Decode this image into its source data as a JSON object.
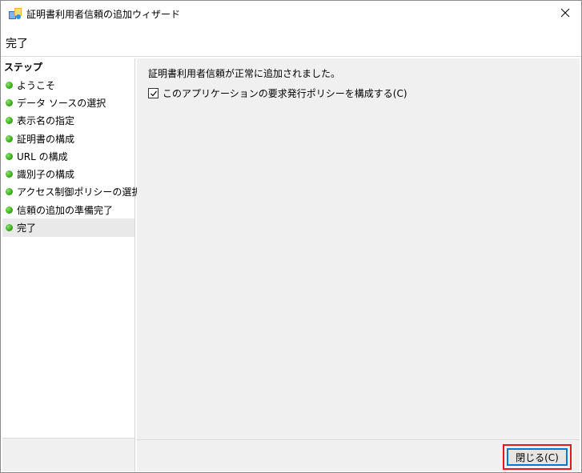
{
  "window": {
    "title": "証明書利用者信頼の追加ウィザード",
    "icon": "trust-wizard-icon",
    "close_icon": "close-icon"
  },
  "header": {
    "page_title": "完了"
  },
  "sidebar": {
    "heading": "ステップ",
    "items": [
      {
        "label": "ようこそ",
        "status": "complete"
      },
      {
        "label": "データ ソースの選択",
        "status": "complete"
      },
      {
        "label": "表示名の指定",
        "status": "complete"
      },
      {
        "label": "証明書の構成",
        "status": "complete"
      },
      {
        "label": "URL の構成",
        "status": "complete"
      },
      {
        "label": "識別子の構成",
        "status": "complete"
      },
      {
        "label": "アクセス制御ポリシーの選択",
        "status": "complete"
      },
      {
        "label": "信頼の追加の準備完了",
        "status": "complete"
      },
      {
        "label": "完了",
        "status": "current"
      }
    ],
    "dot_color": "#3cb01e"
  },
  "content": {
    "message": "証明書利用者信頼が正常に追加されました。",
    "checkbox": {
      "label": "このアプリケーションの要求発行ポリシーを構成する(C)",
      "checked": true
    }
  },
  "footer": {
    "close_button_label": "閉じる(C)",
    "highlight_color": "#e0191e"
  }
}
